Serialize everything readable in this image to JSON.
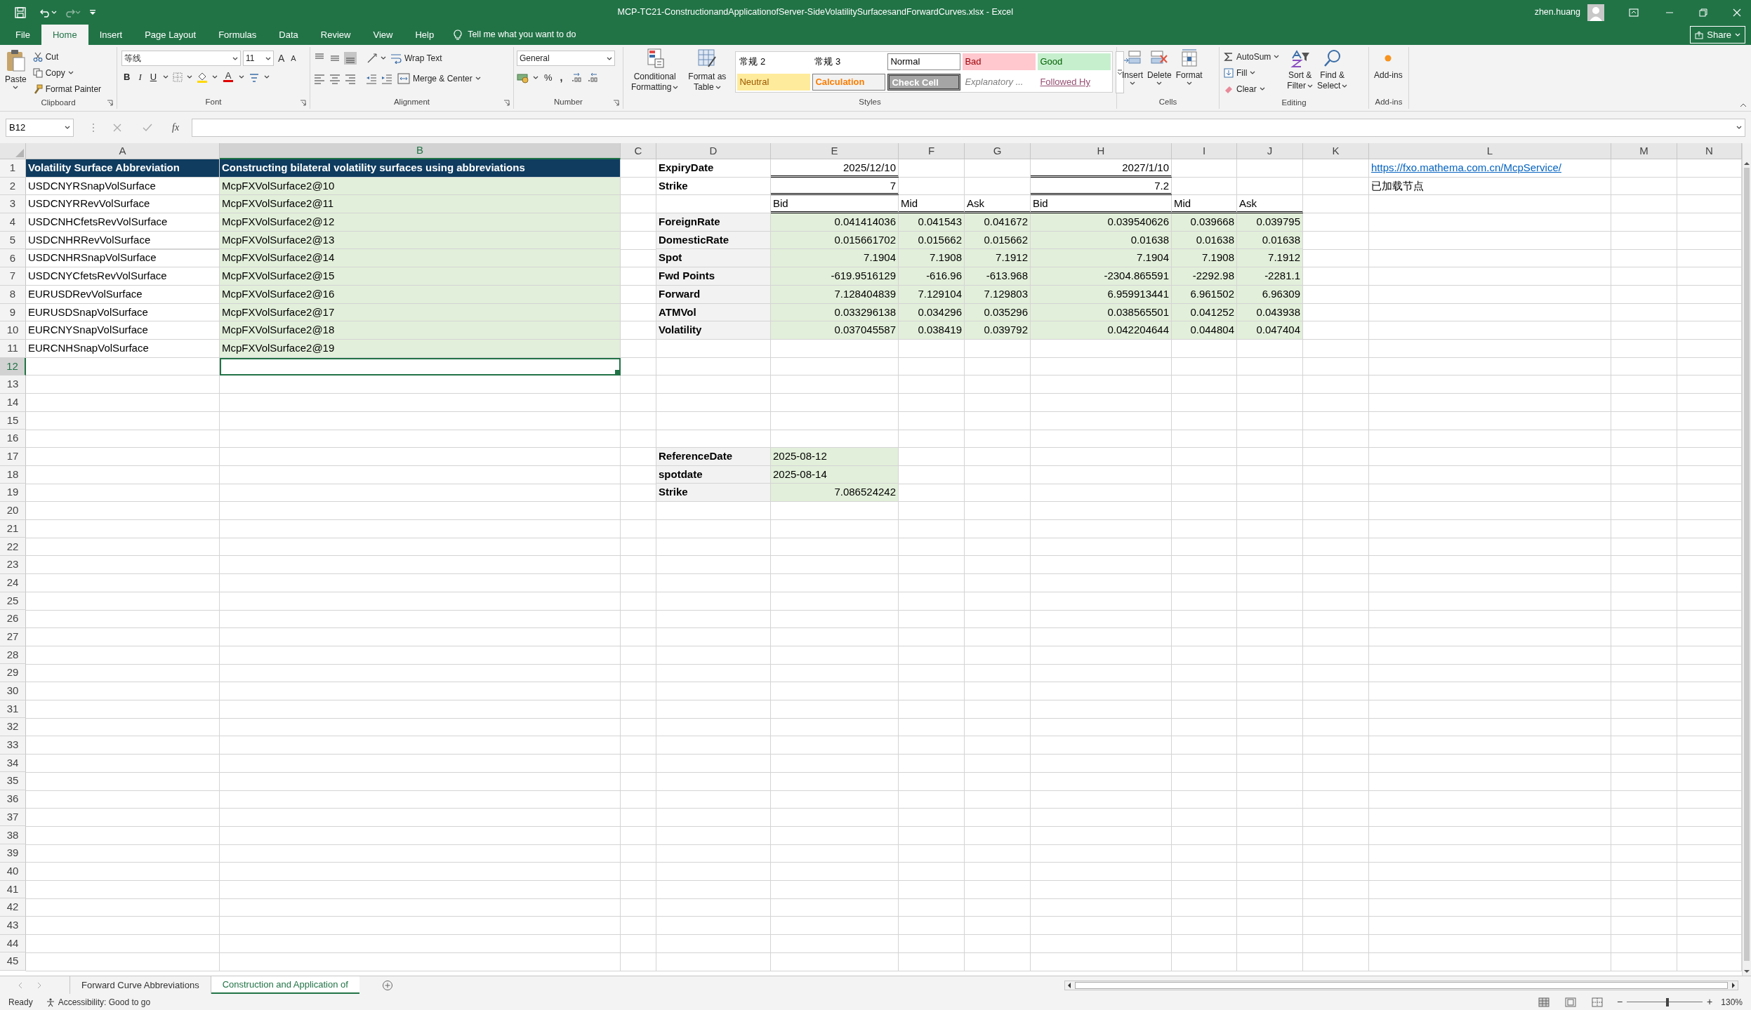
{
  "title_bar": {
    "title": "MCP-TC21-ConstructionandApplicationofServer-SideVolatilitySurfacesandForwardCurves.xlsx  -  Excel",
    "user": "zhen.huang"
  },
  "menu_tabs": [
    {
      "label": "File",
      "selected": false
    },
    {
      "label": "Home",
      "selected": true
    },
    {
      "label": "Insert",
      "selected": false
    },
    {
      "label": "Page Layout",
      "selected": false
    },
    {
      "label": "Formulas",
      "selected": false
    },
    {
      "label": "Data",
      "selected": false
    },
    {
      "label": "Review",
      "selected": false
    },
    {
      "label": "View",
      "selected": false
    },
    {
      "label": "Help",
      "selected": false
    }
  ],
  "tell_me": "Tell me what you want to do",
  "share": "Share",
  "ribbon": {
    "clipboard": {
      "label": "Clipboard",
      "paste": "Paste",
      "cut": "Cut",
      "copy": "Copy",
      "format_painter": "Format Painter"
    },
    "font": {
      "label": "Font",
      "font_name": "等线",
      "font_size": "11",
      "grow": "A",
      "shrink": "A",
      "bold": "B",
      "italic": "I",
      "underline": "U",
      "font_color": "A"
    },
    "alignment": {
      "label": "Alignment",
      "wrap_text": "Wrap Text",
      "merge": "Merge & Center"
    },
    "number": {
      "label": "Number",
      "format": "General",
      "percent": "%",
      "comma": ","
    },
    "styles": {
      "label": "Styles",
      "conditional": [
        "Conditional",
        "Formatting"
      ],
      "table": [
        "Format as",
        "Table"
      ],
      "cells": [
        {
          "label": "常规 2",
          "kind": "plain"
        },
        {
          "label": "常规 3",
          "kind": "plain"
        },
        {
          "label": "Normal",
          "kind": "normal"
        },
        {
          "label": "Bad",
          "kind": "bad"
        },
        {
          "label": "Good",
          "kind": "good"
        },
        {
          "label": "Neutral",
          "kind": "neutral"
        },
        {
          "label": "Calculation",
          "kind": "calculation"
        },
        {
          "label": "Check Cell",
          "kind": "check"
        },
        {
          "label": "Explanatory ...",
          "kind": "explanatory"
        },
        {
          "label": "Followed Hy",
          "kind": "followed"
        }
      ]
    },
    "cells": {
      "label": "Cells",
      "insert": "Insert",
      "delete": "Delete",
      "format": "Format"
    },
    "editing": {
      "label": "Editing",
      "autosum": "AutoSum",
      "fill": "Fill",
      "clear": "Clear",
      "sort": [
        "Sort &",
        "Filter"
      ],
      "find": [
        "Find &",
        "Select"
      ]
    },
    "addins": {
      "label": "Add-ins",
      "button": "Add-ins"
    }
  },
  "formula_bar": {
    "name_box": "B12",
    "function_label": "fx"
  },
  "columns": [
    {
      "label": "A",
      "selected": false
    },
    {
      "label": "B",
      "selected": true
    },
    {
      "label": "C",
      "selected": false
    },
    {
      "label": "D",
      "selected": false
    },
    {
      "label": "E",
      "selected": false
    },
    {
      "label": "F",
      "selected": false
    },
    {
      "label": "G",
      "selected": false
    },
    {
      "label": "H",
      "selected": false
    },
    {
      "label": "I",
      "selected": false
    },
    {
      "label": "J",
      "selected": false
    },
    {
      "label": "K",
      "selected": false
    },
    {
      "label": "L",
      "selected": false
    },
    {
      "label": "M",
      "selected": false
    },
    {
      "label": "N",
      "selected": false
    }
  ],
  "rows": [
    {
      "header": "1",
      "selected": false,
      "cells": [
        {
          "kind": "header",
          "text": "Volatility Surface Abbreviation"
        },
        {
          "kind": "header",
          "text": "Constructing bilateral volatility surfaces using abbreviations"
        },
        null,
        {
          "kind": "bold",
          "text": "ExpiryDate"
        },
        {
          "kind": "input",
          "text": "2025/12/10"
        },
        null,
        null,
        {
          "kind": "input",
          "text": "2027/1/10"
        },
        null,
        null,
        null,
        {
          "kind": "link",
          "text": "https://fxo.mathema.com.cn/McpService/"
        },
        null,
        null
      ]
    },
    {
      "header": "2",
      "selected": false,
      "cells": [
        {
          "kind": "text",
          "text": "USDCNYRSnapVolSurface"
        },
        {
          "kind": "entry",
          "text": "McpFXVolSurface2@10"
        },
        null,
        {
          "kind": "bold",
          "text": "Strike"
        },
        {
          "kind": "input",
          "text": "7"
        },
        null,
        null,
        {
          "kind": "input",
          "text": "7.2"
        },
        null,
        null,
        null,
        {
          "kind": "text",
          "text": "已加载节点"
        },
        null,
        null
      ]
    },
    {
      "header": "3",
      "selected": false,
      "cells": [
        {
          "kind": "text",
          "text": "USDCNYRRevVolSurface"
        },
        {
          "kind": "entry",
          "text": "McpFXVolSurface2@11"
        },
        null,
        null,
        {
          "kind": "column",
          "text": "Bid"
        },
        {
          "kind": "column",
          "text": "Mid"
        },
        {
          "kind": "column",
          "text": "Ask"
        },
        {
          "kind": "column",
          "text": "Bid"
        },
        {
          "kind": "column",
          "text": "Mid"
        },
        {
          "kind": "column",
          "text": "Ask"
        },
        null,
        null,
        null,
        null
      ]
    },
    {
      "header": "4",
      "selected": false,
      "cells": [
        {
          "kind": "text",
          "text": "USDCNHCfetsRevVolSurface"
        },
        {
          "kind": "entry",
          "text": "McpFXVolSurface2@12"
        },
        null,
        {
          "kind": "label",
          "text": "ForeignRate"
        },
        {
          "kind": "number",
          "text": "0.041414036"
        },
        {
          "kind": "number",
          "text": "0.041543"
        },
        {
          "kind": "number",
          "text": "0.041672"
        },
        {
          "kind": "number",
          "text": "0.039540626"
        },
        {
          "kind": "number",
          "text": "0.039668"
        },
        {
          "kind": "number",
          "text": "0.039795"
        },
        null,
        null,
        null,
        null
      ]
    },
    {
      "header": "5",
      "selected": false,
      "cells": [
        {
          "kind": "text",
          "text": "USDCNHRRevVolSurface"
        },
        {
          "kind": "entry",
          "text": "McpFXVolSurface2@13"
        },
        null,
        {
          "kind": "label",
          "text": "DomesticRate"
        },
        {
          "kind": "number",
          "text": "0.015661702"
        },
        {
          "kind": "number",
          "text": "0.015662"
        },
        {
          "kind": "number",
          "text": "0.015662"
        },
        {
          "kind": "number",
          "text": "0.01638"
        },
        {
          "kind": "number",
          "text": "0.01638"
        },
        {
          "kind": "number",
          "text": "0.01638"
        },
        null,
        null,
        null,
        null
      ]
    },
    {
      "header": "6",
      "selected": false,
      "cells": [
        {
          "kind": "text",
          "text": "USDCNHRSnapVolSurface"
        },
        {
          "kind": "entry",
          "text": "McpFXVolSurface2@14"
        },
        null,
        {
          "kind": "label",
          "text": "Spot"
        },
        {
          "kind": "number",
          "text": "7.1904"
        },
        {
          "kind": "number",
          "text": "7.1908"
        },
        {
          "kind": "number",
          "text": "7.1912"
        },
        {
          "kind": "number",
          "text": "7.1904"
        },
        {
          "kind": "number",
          "text": "7.1908"
        },
        {
          "kind": "number",
          "text": "7.1912"
        },
        null,
        null,
        null,
        null
      ]
    },
    {
      "header": "7",
      "selected": false,
      "cells": [
        {
          "kind": "text",
          "text": "USDCNYCfetsRevVolSurface"
        },
        {
          "kind": "entry",
          "text": "McpFXVolSurface2@15"
        },
        null,
        {
          "kind": "label",
          "text": "Fwd Points"
        },
        {
          "kind": "number",
          "text": "-619.9516129"
        },
        {
          "kind": "number",
          "text": "-616.96"
        },
        {
          "kind": "number",
          "text": "-613.968"
        },
        {
          "kind": "number",
          "text": "-2304.865591"
        },
        {
          "kind": "number",
          "text": "-2292.98"
        },
        {
          "kind": "number",
          "text": "-2281.1"
        },
        null,
        null,
        null,
        null
      ]
    },
    {
      "header": "8",
      "selected": false,
      "cells": [
        {
          "kind": "text",
          "text": "EURUSDRevVolSurface"
        },
        {
          "kind": "entry",
          "text": "McpFXVolSurface2@16"
        },
        null,
        {
          "kind": "label",
          "text": "Forward"
        },
        {
          "kind": "number",
          "text": "7.128404839"
        },
        {
          "kind": "number",
          "text": "7.129104"
        },
        {
          "kind": "number",
          "text": "7.129803"
        },
        {
          "kind": "number",
          "text": "6.959913441"
        },
        {
          "kind": "number",
          "text": "6.961502"
        },
        {
          "kind": "number",
          "text": "6.96309"
        },
        null,
        null,
        null,
        null
      ]
    },
    {
      "header": "9",
      "selected": false,
      "cells": [
        {
          "kind": "text",
          "text": "EURUSDSnapVolSurface"
        },
        {
          "kind": "entry",
          "text": "McpFXVolSurface2@17"
        },
        null,
        {
          "kind": "label",
          "text": "ATMVol"
        },
        {
          "kind": "number",
          "text": "0.033296138"
        },
        {
          "kind": "number",
          "text": "0.034296"
        },
        {
          "kind": "number",
          "text": "0.035296"
        },
        {
          "kind": "number",
          "text": "0.038565501"
        },
        {
          "kind": "number",
          "text": "0.041252"
        },
        {
          "kind": "number",
          "text": "0.043938"
        },
        null,
        null,
        null,
        null
      ]
    },
    {
      "header": "10",
      "selected": false,
      "cells": [
        {
          "kind": "text",
          "text": "EURCNYSnapVolSurface"
        },
        {
          "kind": "entry",
          "text": "McpFXVolSurface2@18"
        },
        null,
        {
          "kind": "label",
          "text": "Volatility"
        },
        {
          "kind": "number",
          "text": "0.037045587"
        },
        {
          "kind": "number",
          "text": "0.038419"
        },
        {
          "kind": "number",
          "text": "0.039792"
        },
        {
          "kind": "number",
          "text": "0.042204644"
        },
        {
          "kind": "number",
          "text": "0.044804"
        },
        {
          "kind": "number",
          "text": "0.047404"
        },
        null,
        null,
        null,
        null
      ]
    },
    {
      "header": "11",
      "selected": false,
      "cells": [
        {
          "kind": "text",
          "text": "EURCNHSnapVolSurface"
        },
        {
          "kind": "entry",
          "text": "McpFXVolSurface2@19"
        },
        null,
        null,
        null,
        null,
        null,
        null,
        null,
        null,
        null,
        null,
        null,
        null
      ]
    },
    {
      "header": "12",
      "selected": true
    },
    {
      "header": "13",
      "selected": false
    },
    {
      "header": "14",
      "selected": false
    },
    {
      "header": "15",
      "selected": false
    },
    {
      "header": "16",
      "selected": false
    },
    {
      "header": "17",
      "selected": false,
      "cells": [
        null,
        null,
        null,
        {
          "kind": "label",
          "text": "ReferenceDate"
        },
        {
          "kind": "entry",
          "text": "2025-08-12"
        },
        null,
        null,
        null,
        null,
        null,
        null,
        null,
        null,
        null
      ]
    },
    {
      "header": "18",
      "selected": false,
      "cells": [
        null,
        null,
        null,
        {
          "kind": "label",
          "text": "spotdate"
        },
        {
          "kind": "entry",
          "text": "2025-08-14"
        },
        null,
        null,
        null,
        null,
        null,
        null,
        null,
        null,
        null
      ]
    },
    {
      "header": "19",
      "selected": false,
      "cells": [
        null,
        null,
        null,
        {
          "kind": "label",
          "text": "Strike"
        },
        {
          "kind": "number",
          "text": "7.086524242"
        },
        null,
        null,
        null,
        null,
        null,
        null,
        null,
        null,
        null
      ]
    },
    {
      "header": "20",
      "selected": false
    },
    {
      "header": "21",
      "selected": false
    },
    {
      "header": "22",
      "selected": false
    },
    {
      "header": "23",
      "selected": false
    },
    {
      "header": "24",
      "selected": false
    },
    {
      "header": "25",
      "selected": false
    },
    {
      "header": "26",
      "selected": false
    },
    {
      "header": "27",
      "selected": false
    },
    {
      "header": "28",
      "selected": false
    },
    {
      "header": "29",
      "selected": false
    },
    {
      "header": "30",
      "selected": false
    },
    {
      "header": "31",
      "selected": false
    },
    {
      "header": "32",
      "selected": false
    },
    {
      "header": "33",
      "selected": false
    },
    {
      "header": "34",
      "selected": false
    },
    {
      "header": "35",
      "selected": false
    },
    {
      "header": "36",
      "selected": false
    },
    {
      "header": "37",
      "selected": false
    },
    {
      "header": "38",
      "selected": false
    },
    {
      "header": "39",
      "selected": false
    },
    {
      "header": "40",
      "selected": false
    },
    {
      "header": "41",
      "selected": false
    },
    {
      "header": "42",
      "selected": false
    },
    {
      "header": "43",
      "selected": false
    },
    {
      "header": "44",
      "selected": false
    },
    {
      "header": "45",
      "selected": false
    }
  ],
  "sheet_tabs": [
    {
      "label": "Forward Curve Abbreviations",
      "selected": false
    },
    {
      "label": "Construction and Application of",
      "selected": true
    }
  ],
  "status_bar": {
    "ready": "Ready",
    "accessibility": "Accessibility: Good to go",
    "zoom_out": "−",
    "zoom_in": "+",
    "zoom": "130%",
    "level": 0.54
  }
}
